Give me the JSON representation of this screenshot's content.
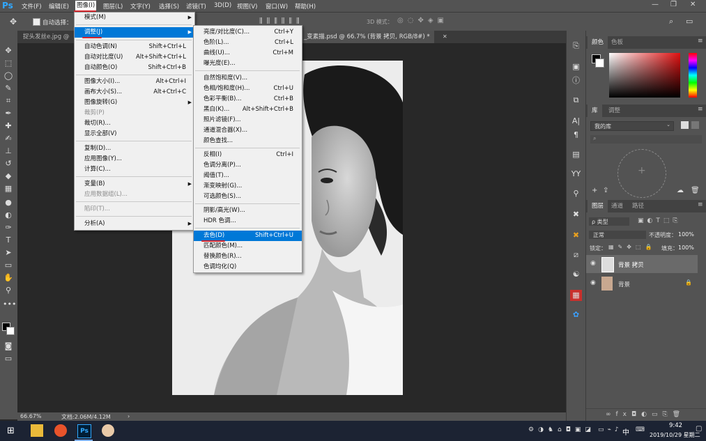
{
  "app": {
    "logo": "Ps"
  },
  "menubar": {
    "items": [
      "文件(F)",
      "编辑(E)",
      "图像(I)",
      "图层(L)",
      "文字(Y)",
      "选择(S)",
      "滤镜(T)",
      "3D(D)",
      "视图(V)",
      "窗口(W)",
      "帮助(H)"
    ]
  },
  "options": {
    "auto_select": "自动选择：",
    "mode3d": "3D 模式："
  },
  "tabs": [
    "捉头发丝e.jpg @",
    "_变素描.psd @ 66.7% (背景 拷贝, RGB/8#) *"
  ],
  "image_menu": {
    "items": [
      {
        "label": "模式(M)",
        "shortcut": "",
        "sub": true
      },
      {
        "label": "调整(J)",
        "shortcut": "",
        "sub": true,
        "hl": true
      },
      {
        "label": "自动色调(N)",
        "shortcut": "Shift+Ctrl+L"
      },
      {
        "label": "自动对比度(U)",
        "shortcut": "Alt+Shift+Ctrl+L"
      },
      {
        "label": "自动颜色(O)",
        "shortcut": "Shift+Ctrl+B"
      },
      {
        "label": "图像大小(I)...",
        "shortcut": "Alt+Ctrl+I"
      },
      {
        "label": "画布大小(S)...",
        "shortcut": "Alt+Ctrl+C"
      },
      {
        "label": "图像旋转(G)",
        "shortcut": "",
        "sub": true
      },
      {
        "label": "裁剪(P)",
        "shortcut": "",
        "dis": true
      },
      {
        "label": "裁切(R)...",
        "shortcut": ""
      },
      {
        "label": "显示全部(V)",
        "shortcut": ""
      },
      {
        "label": "复制(D)...",
        "shortcut": ""
      },
      {
        "label": "应用图像(Y)...",
        "shortcut": ""
      },
      {
        "label": "计算(C)...",
        "shortcut": ""
      },
      {
        "label": "变量(B)",
        "shortcut": "",
        "sub": true
      },
      {
        "label": "应用数据组(L)...",
        "shortcut": "",
        "dis": true
      },
      {
        "label": "陷印(T)...",
        "shortcut": "",
        "dis": true
      },
      {
        "label": "分析(A)",
        "shortcut": "",
        "sub": true
      }
    ]
  },
  "adjust_menu": {
    "items": [
      {
        "label": "亮度/对比度(C)...",
        "shortcut": ""
      },
      {
        "label": "色阶(L)...",
        "shortcut": "Ctrl+L"
      },
      {
        "label": "曲线(U)...",
        "shortcut": "Ctrl+M"
      },
      {
        "label": "曝光度(E)...",
        "shortcut": ""
      },
      {
        "label": "自然饱和度(V)...",
        "shortcut": ""
      },
      {
        "label": "色相/饱和度(H)...",
        "shortcut": "Ctrl+U"
      },
      {
        "label": "色彩平衡(B)...",
        "shortcut": "Ctrl+B"
      },
      {
        "label": "黑白(K)...",
        "shortcut": "Alt+Shift+Ctrl+B"
      },
      {
        "label": "照片滤镜(F)...",
        "shortcut": ""
      },
      {
        "label": "通道混合器(X)...",
        "shortcut": ""
      },
      {
        "label": "颜色查找...",
        "shortcut": ""
      },
      {
        "label": "反相(I)",
        "shortcut": "Ctrl+I"
      },
      {
        "label": "色调分离(P)...",
        "shortcut": ""
      },
      {
        "label": "阈值(T)...",
        "shortcut": ""
      },
      {
        "label": "渐变映射(G)...",
        "shortcut": ""
      },
      {
        "label": "可选颜色(S)...",
        "shortcut": ""
      },
      {
        "label": "阴影/高光(W)...",
        "shortcut": ""
      },
      {
        "label": "HDR 色调...",
        "shortcut": ""
      },
      {
        "label": "去色(D)",
        "shortcut": "Shift+Ctrl+U",
        "hl": true
      },
      {
        "label": "匹配颜色(M)...",
        "shortcut": ""
      },
      {
        "label": "替换颜色(R)...",
        "shortcut": ""
      },
      {
        "label": "色调均化(Q)",
        "shortcut": ""
      }
    ],
    "top_shortcut": "Ctrl+Y"
  },
  "panels": {
    "color_tabs": [
      "颜色",
      "色板"
    ],
    "lib_tabs": [
      "库",
      "调整"
    ],
    "my_library": "我的库",
    "layers_tabs": [
      "图层",
      "通道",
      "路径"
    ],
    "kind": "ρ 类型",
    "blend_mode": "正常",
    "opacity_label": "不透明度：",
    "opacity": "100%",
    "lock_label": "锁定：",
    "fill_label": "填充：",
    "fill": "100%",
    "layers": [
      {
        "name": "背景 拷贝",
        "selected": true
      },
      {
        "name": "背景",
        "selected": false,
        "locked": true
      }
    ]
  },
  "status": {
    "zoom": "66.67%",
    "doc": "文档:2.06M/4.12M"
  },
  "taskbar": {
    "time": "9:42",
    "date": "2019/10/29 星期二",
    "ime": "中"
  },
  "colors": {
    "accent": "#0078d7",
    "ps_bg": "#535353",
    "underline": "#d4262c"
  }
}
